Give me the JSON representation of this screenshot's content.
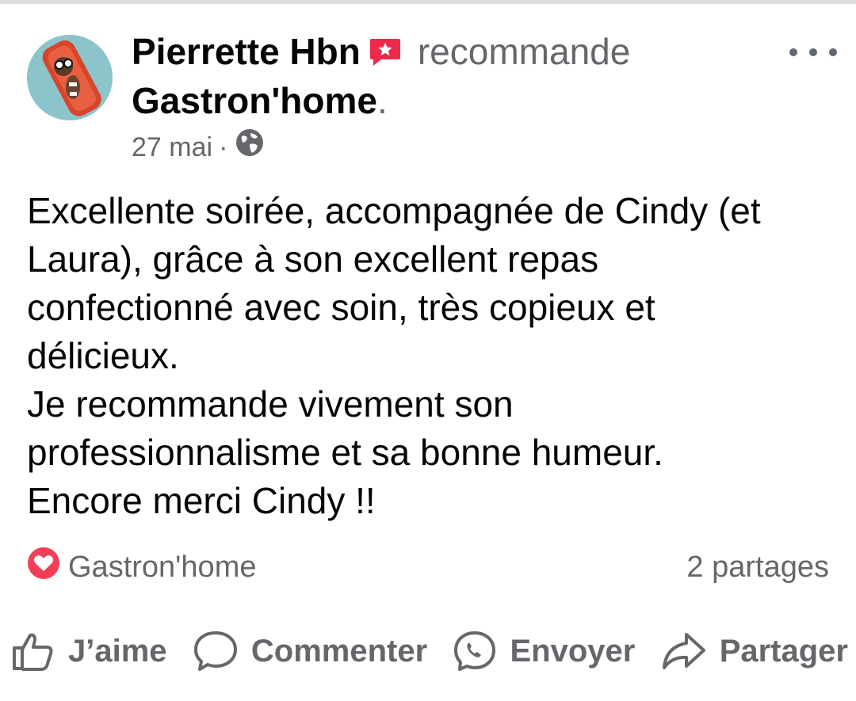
{
  "post": {
    "author": "Pierrette Hbn",
    "action": "recommande",
    "page": "Gastron'home",
    "period": ".",
    "date": "27 mai",
    "separator": "·",
    "body_lines": [
      "Excellente soirée, accompagnée de Cindy (et",
      "Laura), grâce à son excellent repas",
      "confectionné avec soin, très copieux et",
      "délicieux.",
      "Je recommande vivement son",
      "professionnalisme et sa bonne humeur.",
      "Encore merci Cindy !!"
    ]
  },
  "reactions": {
    "reactor": "Gastron'home",
    "shares": "2 partages"
  },
  "actions": {
    "like": "J’aime",
    "comment": "Commenter",
    "send": "Envoyer",
    "share": "Partager"
  },
  "icons": {
    "recommend": "recommend-badge-icon",
    "privacy": "globe-icon",
    "menu": "more-options-icon",
    "reaction": "heart-icon",
    "like": "thumbs-up-icon",
    "comment": "comment-bubble-icon",
    "send": "messenger-icon",
    "share": "share-arrow-icon"
  },
  "colors": {
    "text": "#050505",
    "secondary": "#65676b",
    "recommend_red": "#f0284a",
    "heart_red": "#f33e58"
  }
}
